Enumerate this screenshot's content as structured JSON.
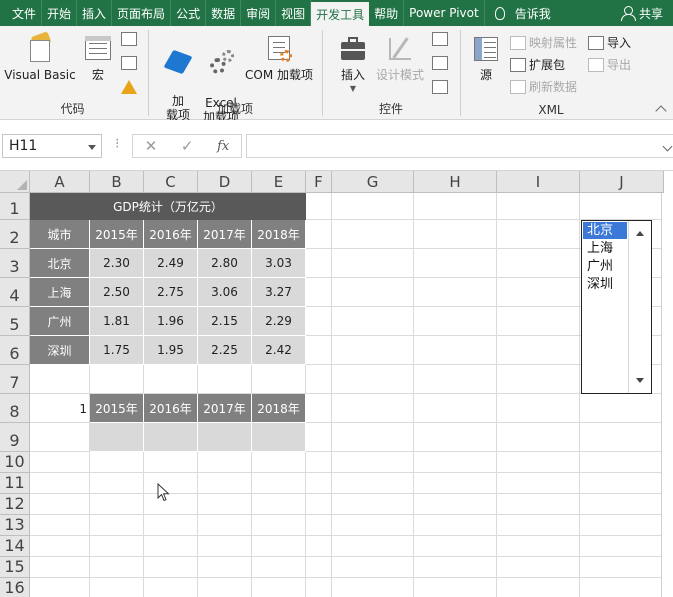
{
  "tabs": [
    {
      "label": "文件",
      "active": false
    },
    {
      "label": "开始",
      "active": false
    },
    {
      "label": "插入",
      "active": false
    },
    {
      "label": "页面布局",
      "active": false
    },
    {
      "label": "公式",
      "active": false
    },
    {
      "label": "数据",
      "active": false
    },
    {
      "label": "审阅",
      "active": false
    },
    {
      "label": "视图",
      "active": false
    },
    {
      "label": "开发工具",
      "active": true
    },
    {
      "label": "帮助",
      "active": false
    },
    {
      "label": "Power Pivot",
      "active": false
    }
  ],
  "tell_me": "告诉我",
  "share": "共享",
  "ribbon": {
    "code_group": {
      "label": "代码",
      "visual_basic": "Visual Basic",
      "macro": "宏"
    },
    "addins_group": {
      "label": "加载项",
      "addins": "加\n载项",
      "excel_addins": "Excel\n加载项",
      "com_addins": "COM 加载项"
    },
    "controls_group": {
      "label": "控件",
      "insert": "插入",
      "design_mode": "设计模式"
    },
    "xml_group": {
      "label": "XML",
      "source": "源",
      "map_properties": "映射属性",
      "expansion_packs": "扩展包",
      "refresh_data": "刷新数据",
      "import": "导入",
      "export": "导出"
    }
  },
  "formula_bar": {
    "name_box": "H11",
    "cancel": "✕",
    "enter": "✓",
    "fx": "fx",
    "formula": ""
  },
  "columns": [
    "A",
    "B",
    "C",
    "D",
    "E",
    "F",
    "G",
    "H",
    "I",
    "J"
  ],
  "rows": [
    "1",
    "2",
    "3",
    "4",
    "5",
    "6",
    "7",
    "8",
    "9",
    "10",
    "11",
    "12",
    "13",
    "14",
    "15",
    "16"
  ],
  "table": {
    "title": "GDP统计（万亿元）",
    "header": [
      "城市",
      "2015年",
      "2016年",
      "2017年",
      "2018年"
    ],
    "rows": [
      [
        "北京",
        "2.30",
        "2.49",
        "2.80",
        "3.03"
      ],
      [
        "上海",
        "2.50",
        "2.75",
        "3.06",
        "3.27"
      ],
      [
        "广州",
        "1.81",
        "1.96",
        "2.15",
        "2.29"
      ],
      [
        "深圳",
        "1.75",
        "1.95",
        "2.25",
        "2.42"
      ]
    ]
  },
  "lookup": {
    "index": "1",
    "header": [
      "2015年",
      "2016年",
      "2017年",
      "2018年"
    ],
    "values": [
      "",
      "",
      "",
      ""
    ]
  },
  "listbox": {
    "items": [
      "北京",
      "上海",
      "广州",
      "深圳"
    ],
    "selected": "北京"
  }
}
